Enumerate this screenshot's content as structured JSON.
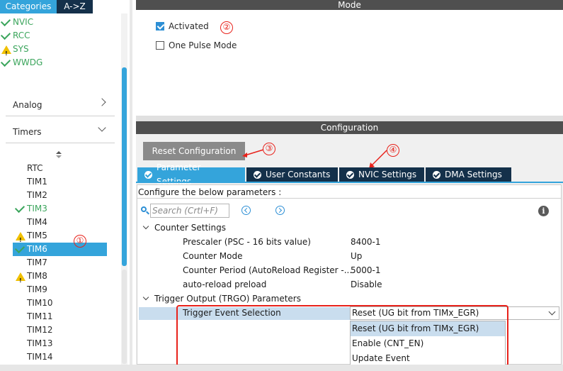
{
  "left": {
    "tabs": [
      "Categories",
      "A->Z"
    ],
    "system_items": [
      {
        "label": "NVIC",
        "status": "ok"
      },
      {
        "label": "RCC",
        "status": "ok"
      },
      {
        "label": "SYS",
        "status": "warn"
      },
      {
        "label": "WWDG",
        "status": "ok"
      }
    ],
    "sections": {
      "analog": "Analog",
      "timers": "Timers"
    },
    "timer_items": [
      {
        "label": "RTC",
        "status": "none"
      },
      {
        "label": "TIM1",
        "status": "none"
      },
      {
        "label": "TIM2",
        "status": "none"
      },
      {
        "label": "TIM3",
        "status": "ok"
      },
      {
        "label": "TIM4",
        "status": "none"
      },
      {
        "label": "TIM5",
        "status": "warn"
      },
      {
        "label": "TIM6",
        "status": "ok",
        "selected": true
      },
      {
        "label": "TIM7",
        "status": "none"
      },
      {
        "label": "TIM8",
        "status": "warn"
      },
      {
        "label": "TIM9",
        "status": "none"
      },
      {
        "label": "TIM10",
        "status": "none"
      },
      {
        "label": "TIM11",
        "status": "none"
      },
      {
        "label": "TIM12",
        "status": "none"
      },
      {
        "label": "TIM13",
        "status": "none"
      },
      {
        "label": "TIM14",
        "status": "none"
      }
    ]
  },
  "mode": {
    "title": "Mode",
    "activated_label": "Activated",
    "activated_checked": true,
    "one_pulse_label": "One Pulse Mode",
    "one_pulse_checked": false
  },
  "config": {
    "title": "Configuration",
    "reset_label": "Reset Configuration",
    "tabs": [
      "Parameter Settings",
      "User Constants",
      "NVIC Settings",
      "DMA Settings"
    ],
    "active_tab": "Parameter Settings",
    "description": "Configure the below parameters :",
    "search_placeholder": "Search (Crtl+F)",
    "info_icon": "i",
    "groups": {
      "counter": "Counter Settings",
      "trigger": "Trigger Output (TRGO) Parameters"
    },
    "params": [
      {
        "name": "Prescaler (PSC - 16 bits value)",
        "value": "8400-1"
      },
      {
        "name": "Counter Mode",
        "value": "Up"
      },
      {
        "name": "Counter Period (AutoReload Register -...",
        "value": "5000-1"
      },
      {
        "name": "auto-reload preload",
        "value": "Disable"
      }
    ],
    "trigger_param": {
      "name": "Trigger Event Selection",
      "value": "Reset (UG bit from TIMx_EGR)"
    },
    "trigger_options": [
      "Reset (UG bit from TIMx_EGR)",
      "Enable (CNT_EN)",
      "Update Event"
    ]
  },
  "annotations": [
    "①",
    "②",
    "③",
    "④"
  ],
  "colors": {
    "accent": "#34a4db",
    "dark_tab": "#14304a",
    "ok": "#3ba55c",
    "warn": "#f0c000",
    "annotation": "#e8221b"
  }
}
